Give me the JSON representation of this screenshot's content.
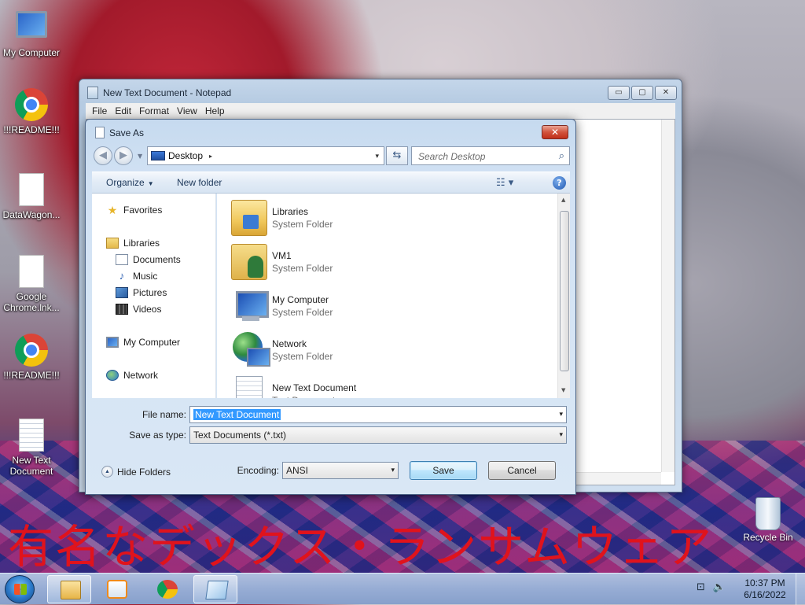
{
  "desktop": {
    "icons": [
      {
        "label": "My Computer",
        "icon": "computer-icon"
      },
      {
        "label": "!!!README!!!",
        "icon": "chrome-icon"
      },
      {
        "label": "DataWagon...",
        "icon": "document-icon"
      },
      {
        "label": "Google Chrome.lnk...",
        "icon": "document-icon"
      },
      {
        "label": "!!!README!!!",
        "icon": "chrome-icon"
      },
      {
        "label": "New Text Document",
        "icon": "text-document-icon"
      }
    ],
    "recycle_bin": "Recycle Bin",
    "wallpaper_text": "有名なデックス・ランサムウェア"
  },
  "notepad": {
    "title": "New Text Document - Notepad",
    "menu": [
      "File",
      "Edit",
      "Format",
      "View",
      "Help"
    ],
    "controls": {
      "minimize": "▭",
      "maximize": "▢",
      "close": "✕"
    }
  },
  "save_dialog": {
    "title": "Save As",
    "close": "✕",
    "address": {
      "location": "Desktop",
      "chevron": "▸",
      "dropdown": "▾"
    },
    "refresh": "⇆",
    "search": {
      "placeholder": "Search Desktop",
      "icon": "⌕"
    },
    "toolbar": {
      "organize": "Organize",
      "new_folder": "New folder",
      "views": "☷ ▾",
      "help": "?"
    },
    "nav": {
      "favorites": "Favorites",
      "libraries": "Libraries",
      "library_items": [
        "Documents",
        "Music",
        "Pictures",
        "Videos"
      ],
      "computer": "My Computer",
      "network": "Network"
    },
    "files": [
      {
        "name": "Libraries",
        "type": "System Folder"
      },
      {
        "name": "VM1",
        "type": "System Folder"
      },
      {
        "name": "My Computer",
        "type": "System Folder"
      },
      {
        "name": "Network",
        "type": "System Folder"
      },
      {
        "name": "New Text Document",
        "type": "Text Document"
      }
    ],
    "file_name_label": "File name:",
    "file_name_value": "New Text Document",
    "save_type_label": "Save as type:",
    "save_type_value": "Text Documents (*.txt)",
    "hide_folders": "Hide Folders",
    "encoding_label": "Encoding:",
    "encoding_value": "ANSI",
    "save_button": "Save",
    "cancel_button": "Cancel",
    "dropdown_glyph": "▾"
  },
  "taskbar": {
    "apps": [
      "explorer",
      "media-player",
      "chrome",
      "notepad"
    ],
    "tray_icons": [
      "network-icon",
      "volume-icon"
    ],
    "time": "10:37 PM",
    "date": "6/16/2022"
  }
}
